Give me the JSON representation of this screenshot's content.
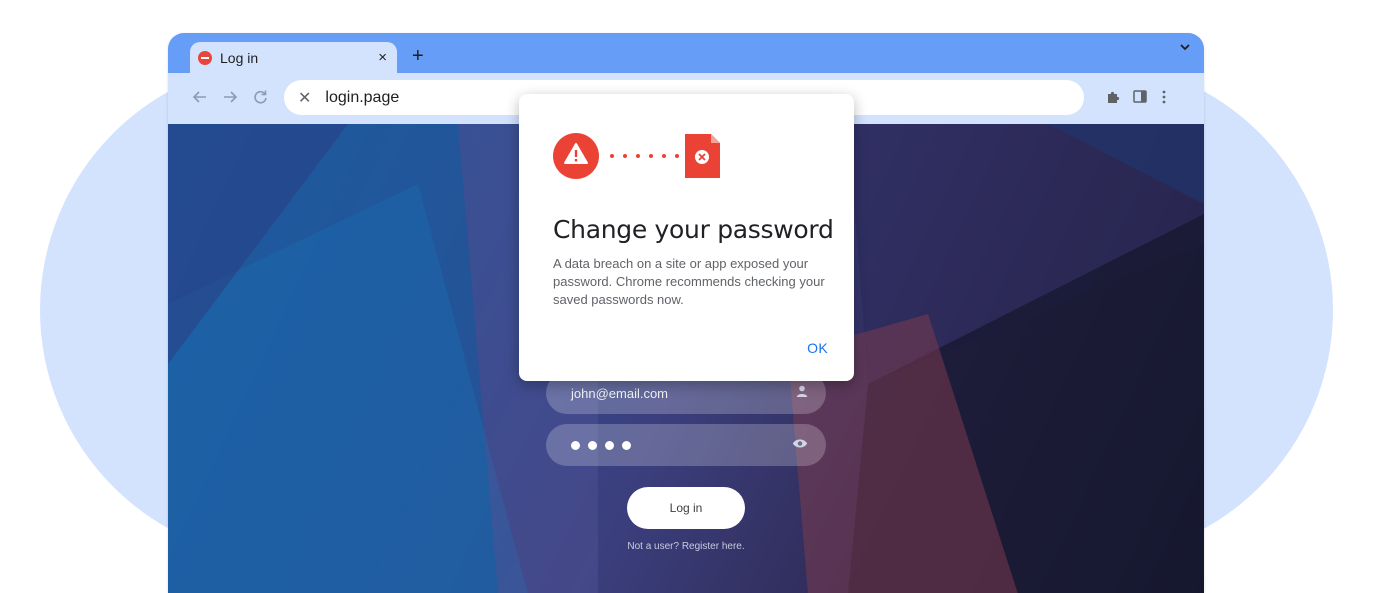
{
  "browser": {
    "tab": {
      "title": "Log in",
      "close_glyph": "×"
    },
    "new_tab_glyph": "+",
    "address_bar": {
      "url": "login.page",
      "stop_glyph": "✕"
    },
    "icons": [
      "back-arrow-icon",
      "forward-arrow-icon",
      "reload-icon",
      "extensions-icon",
      "side-panel-icon",
      "more-menu-icon",
      "tab-search-chevron-icon"
    ]
  },
  "login_form": {
    "email_value": "john@email.com",
    "password_length": 4,
    "login_button": "Log in",
    "register_link": "Not a user? Register here."
  },
  "dialog": {
    "title": "Change your password",
    "body": "A data breach on a site or app exposed your password. Chrome recommends checking your saved passwords now.",
    "ok_label": "OK"
  },
  "colors": {
    "accent": "#1a73e8",
    "warning_red": "#ea4335",
    "tabstrip": "#669df6",
    "toolbar": "#d3e3fd"
  }
}
